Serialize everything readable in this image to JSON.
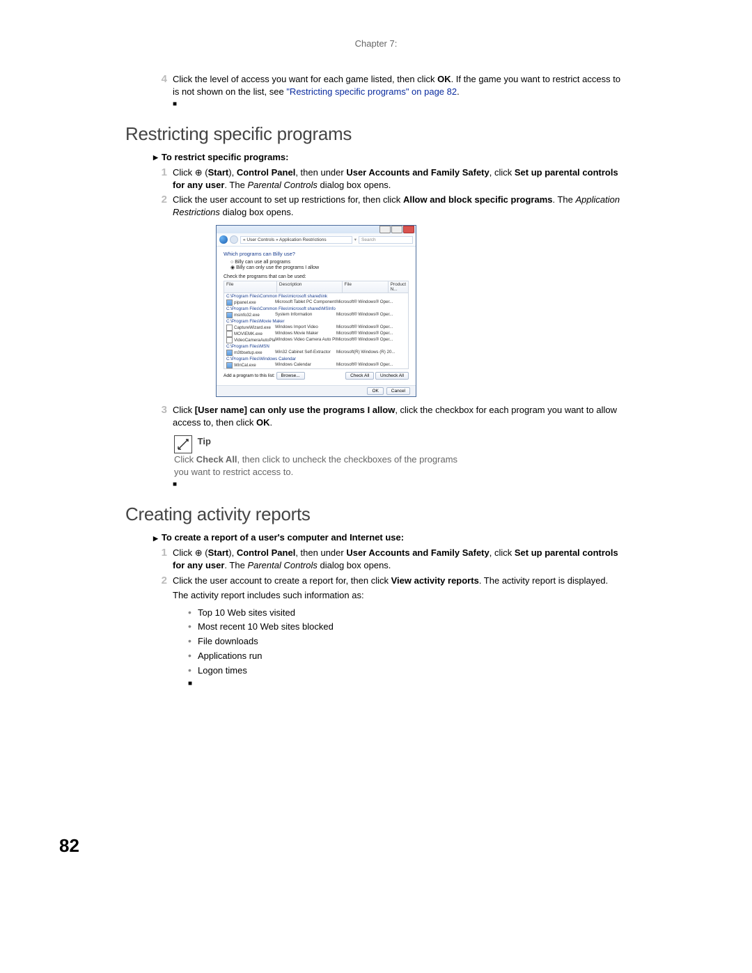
{
  "chapter": "Chapter 7:",
  "step4": {
    "num": "4",
    "pre": "Click the level of access you want for each game listed, then click ",
    "ok": "OK",
    "mid": ". If the game you want to restrict access to is not shown on the list, see ",
    "link": "\"Restricting specific programs\" on page 82",
    "post": "."
  },
  "section1": {
    "title": "Restricting specific programs",
    "task": "To restrict specific programs:",
    "steps": {
      "s1": {
        "num": "1",
        "t1": "Click ",
        "start": "Start",
        "t2": "), ",
        "cp": "Control Panel",
        "t3": ", then under ",
        "ua": "User Accounts and Family Safety",
        "t4": ", click ",
        "setup": "Set up parental controls for any user",
        "t5": ". The ",
        "pc": "Parental Controls",
        "t6": " dialog box opens."
      },
      "s2": {
        "num": "2",
        "t1": "Click the user account to set up restrictions for, then click ",
        "ab": "Allow and block specific programs",
        "t2": ". The ",
        "ar": "Application Restrictions",
        "t3": " dialog box opens."
      },
      "s3": {
        "num": "3",
        "t1": "Click ",
        "un": "[User name] can only use the programs I allow",
        "t2": ", click the checkbox for each program you want to allow access to, then click ",
        "ok": "OK",
        "t3": "."
      }
    }
  },
  "dialog": {
    "breadcrumb": "« User Controls » Application Restrictions",
    "search": "Search",
    "heading": "Which programs can Billy use?",
    "opt1": "Billy can use all programs",
    "opt2": "Billy can only use the programs I allow",
    "checkLabel": "Check the programs that can be used:",
    "cols": {
      "file": "File",
      "desc": "Description",
      "file2": "File",
      "pn": "Product N..."
    },
    "groups": [
      {
        "label": "C:\\Program Files\\Common Files\\microsoft shared\\ink",
        "rows": [
          {
            "chk": true,
            "file": "pipanel.exe",
            "desc": "Microsoft Tablet PC Component",
            "pn": "Microsoft® Windows® Oper..."
          }
        ]
      },
      {
        "label": "C:\\Program Files\\Common Files\\microsoft shared\\MSInfo",
        "rows": [
          {
            "chk": true,
            "file": "msinfo32.exe",
            "desc": "System Information",
            "pn": "Microsoft® Windows® Oper..."
          }
        ]
      },
      {
        "label": "C:\\Program Files\\Movie Maker",
        "rows": [
          {
            "chk": false,
            "file": "CaptureWizard.exe",
            "desc": "Windows Import Video",
            "pn": "Microsoft® Windows® Oper..."
          },
          {
            "chk": false,
            "file": "MOVIEMK.exe",
            "desc": "Windows Movie Maker",
            "pn": "Microsoft® Windows® Oper..."
          },
          {
            "chk": false,
            "file": "VideoCameraAutoPlay...",
            "desc": "Windows Video Camera Auto Pla...",
            "pn": "Microsoft® Windows® Oper..."
          }
        ]
      },
      {
        "label": "C:\\Program Files\\MSN",
        "rows": [
          {
            "chk": true,
            "file": "m3tbsetup.exe",
            "desc": "Win32 Cabinet Self-Extractor",
            "pn": "Microsoft(R) Windows (R) 20..."
          }
        ]
      },
      {
        "label": "C:\\Program Files\\Windows Calendar",
        "rows": [
          {
            "chk": true,
            "file": "WinCal.exe",
            "desc": "Windows Calendar",
            "pn": "Microsoft® Windows® Oper..."
          }
        ]
      }
    ],
    "addLabel": "Add a program to this list:",
    "browse": "Browse...",
    "checkAll": "Check All",
    "uncheckAll": "Uncheck All",
    "ok": "OK",
    "cancel": "Cancel"
  },
  "tip": {
    "title": "Tip",
    "t1": "Click ",
    "ca": "Check All",
    "t2": ", then click to uncheck the checkboxes of the programs you want to restrict access to."
  },
  "section2": {
    "title": "Creating activity reports",
    "task": "To create a report of a user's computer and Internet use:",
    "steps": {
      "s1": {
        "num": "1",
        "t1": "Click ",
        "start": "Start",
        "t2": "), ",
        "cp": "Control Panel",
        "t3": ", then under ",
        "ua": "User Accounts and Family Safety",
        "t4": ", click ",
        "setup": "Set up parental controls for any user",
        "t5": ". The ",
        "pc": "Parental Controls",
        "t6": " dialog box opens."
      },
      "s2": {
        "num": "2",
        "t1": "Click the user account to create a report for, then click ",
        "var": "View activity reports",
        "t2": ". The activity report is displayed."
      }
    },
    "info": "The activity report includes such information as:",
    "bullets": [
      "Top 10 Web sites visited",
      "Most recent 10 Web sites blocked",
      "File downloads",
      "Applications run",
      "Logon times"
    ]
  },
  "pageNum": "82"
}
